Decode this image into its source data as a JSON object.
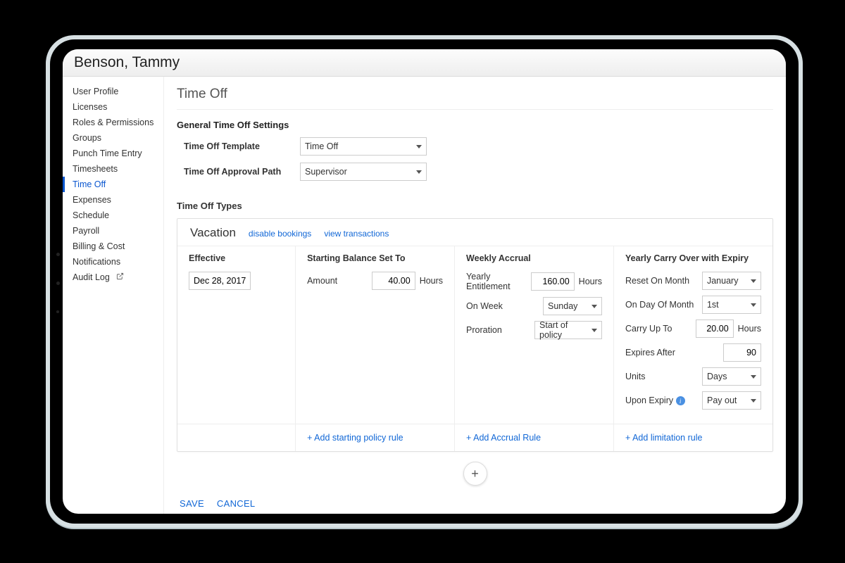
{
  "header": {
    "user_name": "Benson, Tammy"
  },
  "sidebar": {
    "items": [
      {
        "label": "User Profile"
      },
      {
        "label": "Licenses"
      },
      {
        "label": "Roles & Permissions"
      },
      {
        "label": "Groups"
      },
      {
        "label": "Punch Time Entry"
      },
      {
        "label": "Timesheets"
      },
      {
        "label": "Time Off",
        "active": true
      },
      {
        "label": "Expenses"
      },
      {
        "label": "Schedule"
      },
      {
        "label": "Payroll"
      },
      {
        "label": "Billing & Cost"
      },
      {
        "label": "Notifications"
      },
      {
        "label": "Audit Log",
        "external": true
      }
    ]
  },
  "main": {
    "title": "Time Off",
    "general": {
      "heading": "General Time Off Settings",
      "template_label": "Time Off Template",
      "template_value": "Time Off",
      "approval_label": "Time Off Approval Path",
      "approval_value": "Supervisor"
    },
    "types_heading": "Time Off Types",
    "vacation": {
      "name": "Vacation",
      "disable_link": "disable bookings",
      "view_link": "view transactions",
      "effective": {
        "heading": "Effective",
        "date": "Dec 28, 2017"
      },
      "starting": {
        "heading": "Starting Balance Set To",
        "amount_label": "Amount",
        "amount_value": "40.00",
        "amount_unit": "Hours",
        "add_link": "+ Add starting policy rule"
      },
      "accrual": {
        "heading": "Weekly Accrual",
        "entitlement_label": "Yearly Entitlement",
        "entitlement_value": "160.00",
        "entitlement_unit": "Hours",
        "on_week_label": "On Week",
        "on_week_value": "Sunday",
        "proration_label": "Proration",
        "proration_value": "Start of policy",
        "add_link": "+ Add Accrual Rule"
      },
      "carry": {
        "heading": "Yearly Carry Over with Expiry",
        "reset_month_label": "Reset On Month",
        "reset_month_value": "January",
        "on_day_label": "On Day Of Month",
        "on_day_value": "1st",
        "carry_up_label": "Carry Up To",
        "carry_up_value": "20.00",
        "carry_up_unit": "Hours",
        "expires_label": "Expires After",
        "expires_value": "90",
        "units_label": "Units",
        "units_value": "Days",
        "upon_expiry_label": "Upon Expiry",
        "upon_expiry_value": "Pay out",
        "add_link": "+ Add limitation rule"
      }
    },
    "fab": "+",
    "actions": {
      "save": "SAVE",
      "cancel": "CANCEL"
    }
  }
}
